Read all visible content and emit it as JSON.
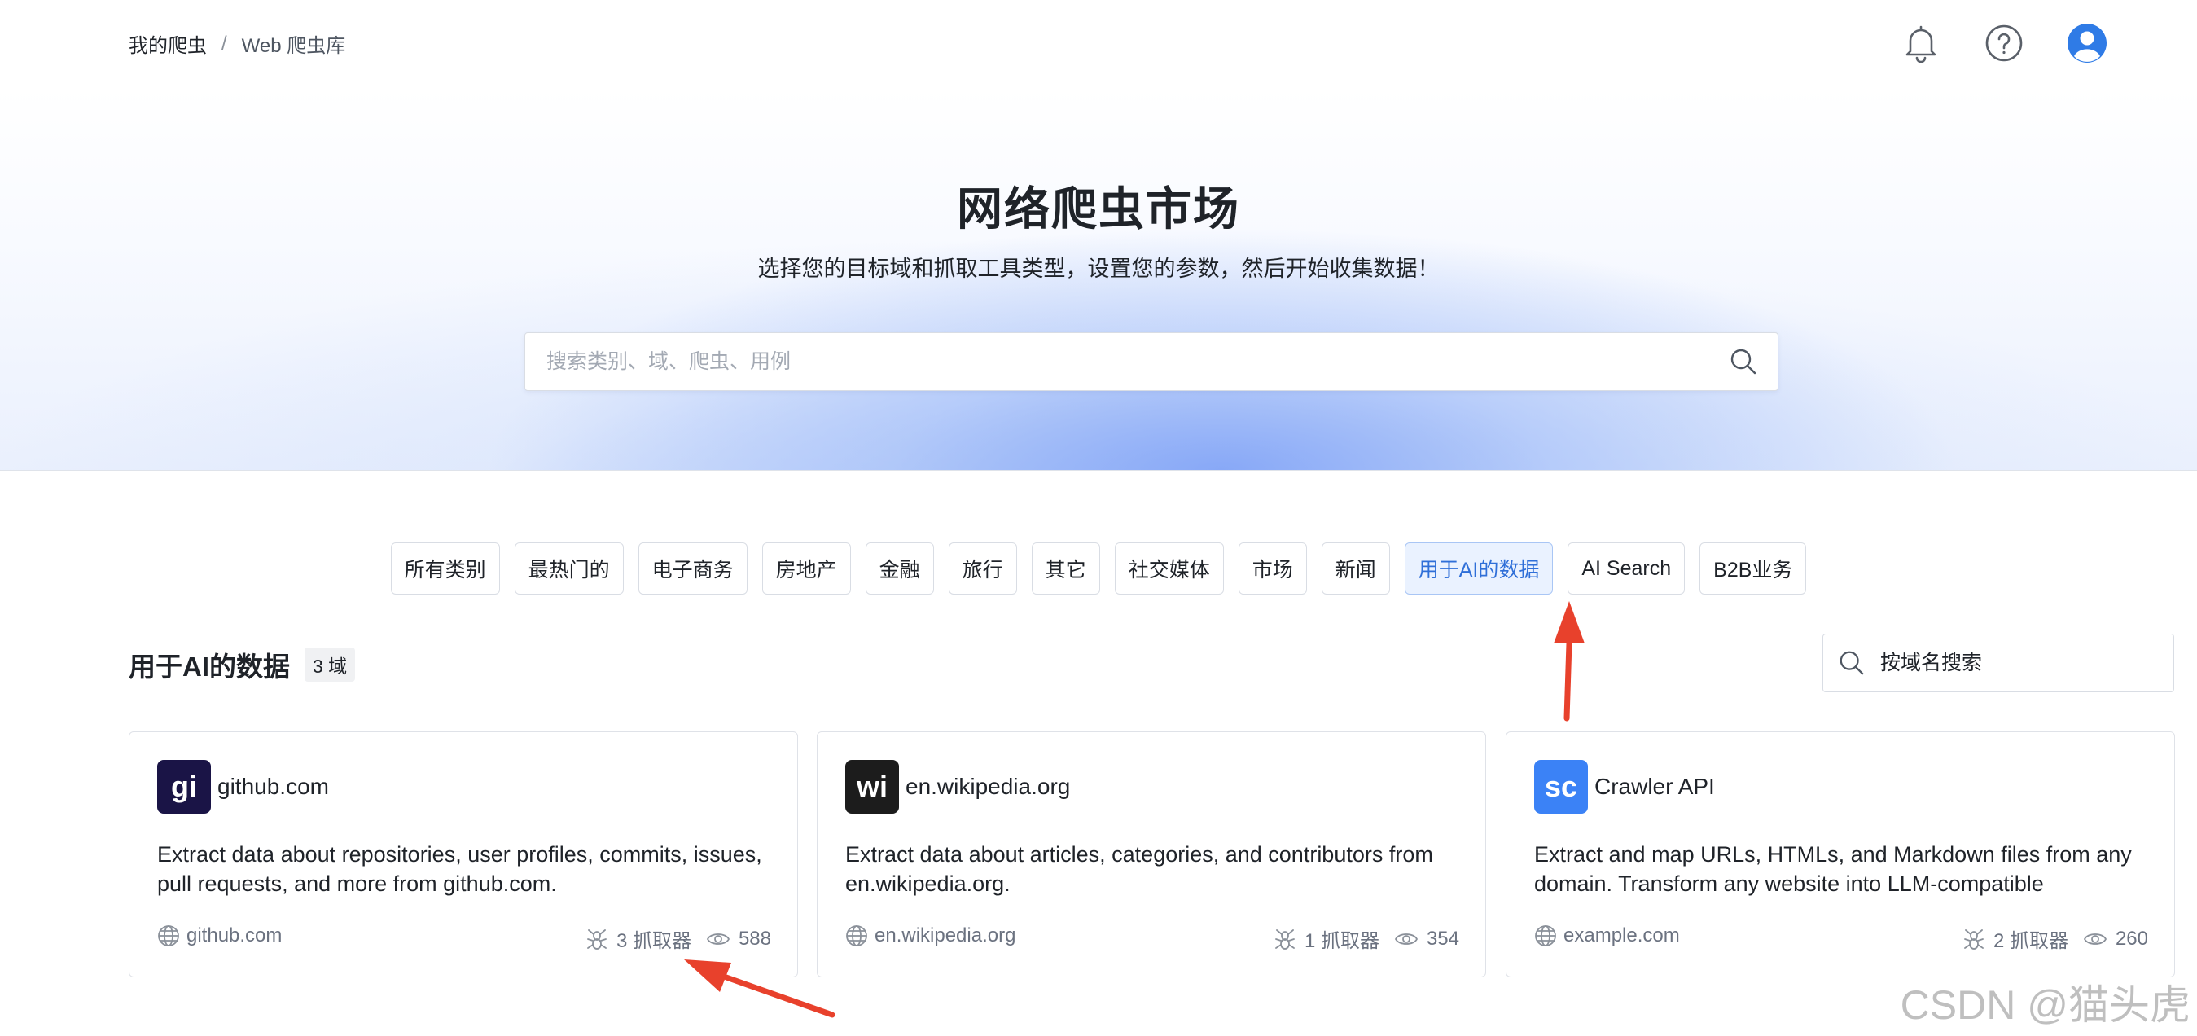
{
  "breadcrumb": {
    "root": "我的爬虫",
    "separator": "/",
    "current": "Web 爬虫库"
  },
  "header_icons": [
    "bell-icon",
    "help-circle-icon",
    "user-avatar-icon"
  ],
  "hero": {
    "title": "网络爬虫市场",
    "subtitle": "选择您的目标域和抓取工具类型，设置您的参数，然后开始收集数据！",
    "search_placeholder": "搜索类别、域、爬虫、用例"
  },
  "categories": [
    {
      "label": "所有类别",
      "active": false
    },
    {
      "label": "最热门的",
      "active": false
    },
    {
      "label": "电子商务",
      "active": false
    },
    {
      "label": "房地产",
      "active": false
    },
    {
      "label": "金融",
      "active": false
    },
    {
      "label": "旅行",
      "active": false
    },
    {
      "label": "其它",
      "active": false
    },
    {
      "label": "社交媒体",
      "active": false
    },
    {
      "label": "市场",
      "active": false
    },
    {
      "label": "新闻",
      "active": false
    },
    {
      "label": "用于AI的数据",
      "active": true
    },
    {
      "label": "AI Search",
      "active": false
    },
    {
      "label": "B2B业务",
      "active": false
    }
  ],
  "section": {
    "title": "用于AI的数据",
    "count": "3 域",
    "domain_search_placeholder": "按域名搜索"
  },
  "cards": [
    {
      "avatar": "gi",
      "avatar_color": "#1a1446",
      "name": "github.com",
      "description": "Extract data about repositories, user profiles, commits, issues, pull requests, and more from github.com.",
      "domain": "github.com",
      "scrapers": "3 抓取器",
      "views": "588"
    },
    {
      "avatar": "wi",
      "avatar_color": "#1c1c1c",
      "name": "en.wikipedia.org",
      "description": "Extract data about articles, categories, and contributors from en.wikipedia.org.",
      "domain": "en.wikipedia.org",
      "scrapers": "1 抓取器",
      "views": "354"
    },
    {
      "avatar": "sc",
      "avatar_color": "#3b82f6",
      "name": "Crawler API",
      "description": "Extract and map URLs, HTMLs, and Markdown files from any domain. Transform any website into LLM-compatible",
      "domain": "example.com",
      "scrapers": "2 抓取器",
      "views": "260"
    }
  ],
  "colors": {
    "accent": "#2f6fd8",
    "active_chip_bg": "#eaf2ff",
    "annotation_arrow": "#e8412c"
  },
  "watermark": "CSDN @猫头虎"
}
